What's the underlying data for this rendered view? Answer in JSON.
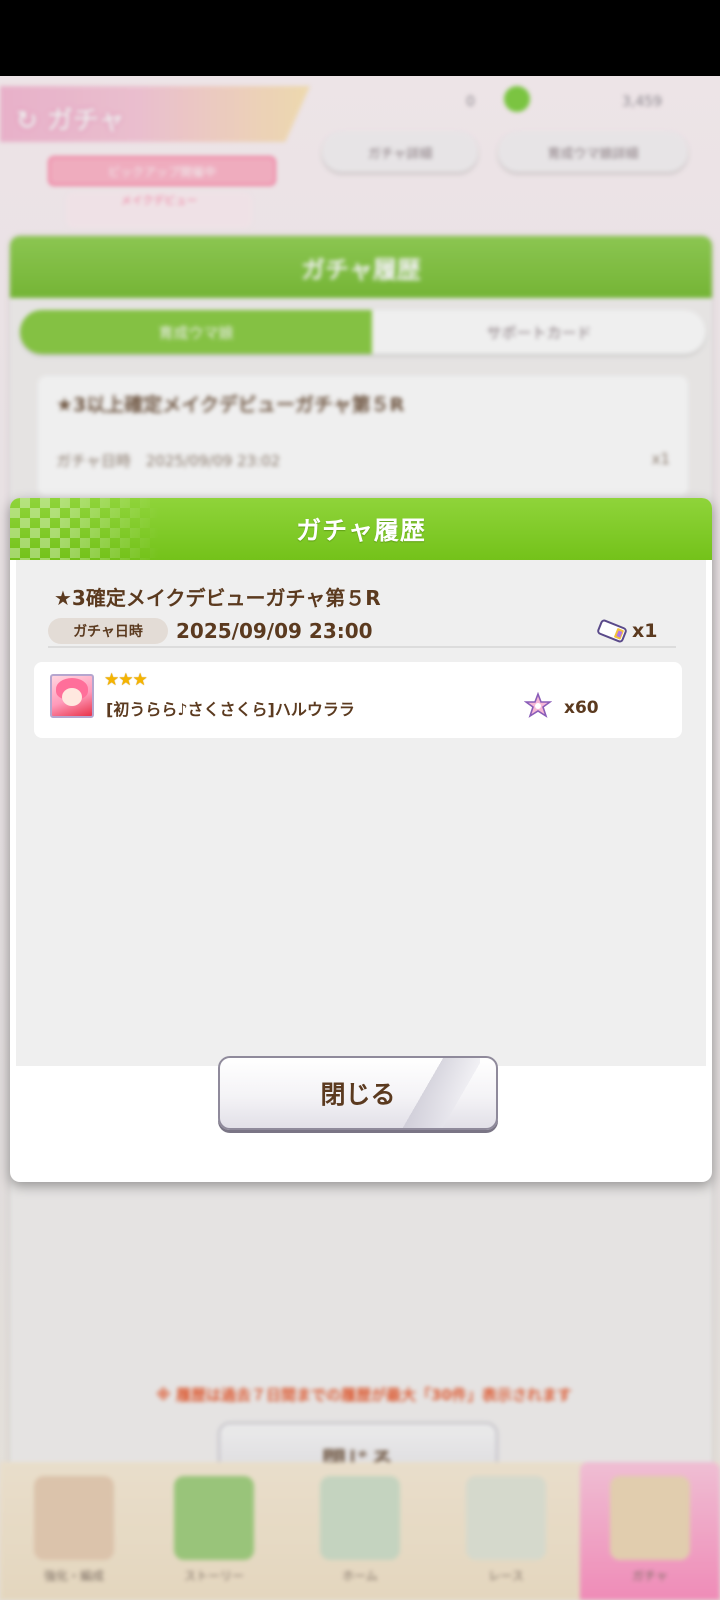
{
  "background": {
    "gacha_tab_title": "ガチャ",
    "currency_a": "0",
    "currency_b": "3,459",
    "pill_left": "ガチャ詳細",
    "pill_right": "育成ウマ娘詳細",
    "event_tag": "ピックアップ開催中",
    "event_sub": "メイクデビュー",
    "panel": {
      "title": "ガチャ履歴",
      "tab_active": "育成ウマ娘",
      "tab_inactive": "サポートカード",
      "card_title": "★3以上確定メイクデビューガチャ第５R",
      "card_date": "ガチャ日時　2025/09/09 23:02",
      "card_count": "x1",
      "notice": "※ 履歴は過去７日間までの履歴が最大「30件」表示されます",
      "close": "閉じる"
    },
    "nav": [
      "強化・編成",
      "ストーリー",
      "ホーム",
      "レース",
      "ガチャ"
    ]
  },
  "modal": {
    "title": "ガチャ履歴",
    "entry": {
      "title": "★3確定メイクデビューガチャ第５R",
      "date_label": "ガチャ日時",
      "date_value": "2025/09/09 23:00",
      "ticket_icon": "ticket-icon",
      "ticket_count": "x1"
    },
    "results": [
      {
        "stars": "★★★",
        "rarity": 3,
        "name": "[初うらら♪さくさくら]ハルウララ",
        "piece_icon": "star-piece-icon",
        "piece_count": "x60"
      }
    ],
    "close_label": "閉じる"
  },
  "colors": {
    "header_green": "#7cc42a",
    "text_brown": "#5b3a1f",
    "star_gold": "#f5b400",
    "notice_red": "#ea5a2e"
  }
}
